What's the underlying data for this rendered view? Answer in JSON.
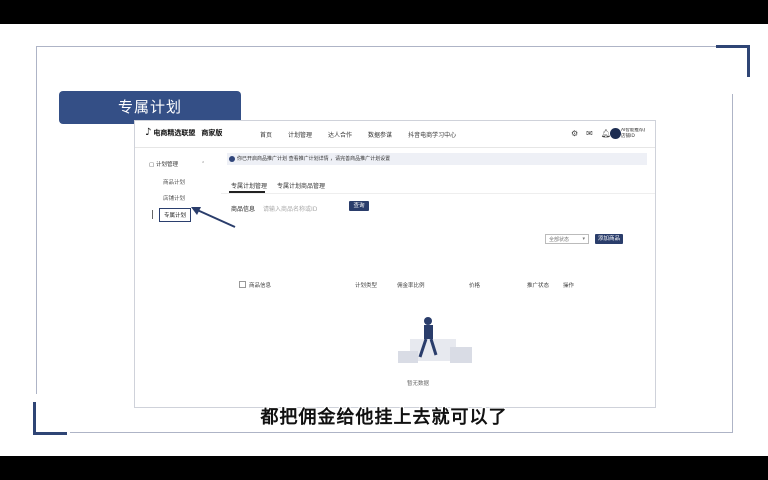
{
  "slide_title": "专属计划",
  "header": {
    "logo_name": "电商精选联盟",
    "logo_edition": "商家版",
    "nav": [
      "首页",
      "计划管理",
      "达人合作",
      "数据参谋",
      "抖音电商学习中心"
    ],
    "user_name": "AI智能推荐旗舰店",
    "user_sub": "店铺ID"
  },
  "sidebar": {
    "section": "计划管理",
    "items": [
      "商品计划",
      "店铺计划",
      "专属计划"
    ],
    "active": "专属计划"
  },
  "notice": "你已开启商品推广计划 查看推广计划详情 ，请完善商品推广计划设置",
  "tabs": [
    "专属计划管理",
    "专属计划商品管理"
  ],
  "filter": {
    "label": "商品信息",
    "placeholder": "请输入商品名称或ID",
    "search_button": "查询"
  },
  "toolbar": {
    "select_value": "全部状态",
    "add_button": "添加商品"
  },
  "table": {
    "columns": [
      "商品信息",
      "计划类型",
      "佣金率比例",
      "价格",
      "推广状态",
      "操作"
    ]
  },
  "empty_text": "暂无数据",
  "caption": "都把佣金给他挂上去就可以了",
  "colors": {
    "accent": "#344f86",
    "button": "#2a3d6b",
    "frame": "#aeb4c6"
  }
}
